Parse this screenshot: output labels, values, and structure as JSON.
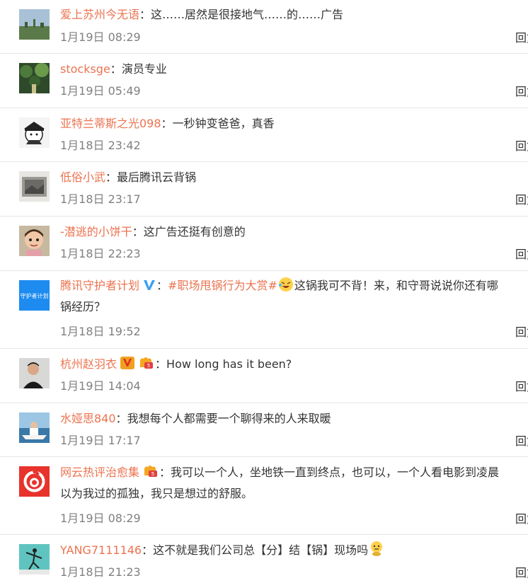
{
  "colors": {
    "username": "#eb7350",
    "time": "#808080",
    "text": "#333333",
    "divider": "#e6e6e6"
  },
  "comments": [
    {
      "user": "爱上苏州今无语",
      "colon": "：",
      "text": "这……居然是很接地气……的……广告",
      "time": "1月19日 08:29",
      "avatar_icon": "landscape-avatar-icon"
    },
    {
      "user": "stocksge",
      "colon": "：",
      "text": "演员专业",
      "time": "1月19日 05:49",
      "avatar_icon": "forest-avatar-icon"
    },
    {
      "user": "亚特兰蒂斯之光098",
      "colon": "：",
      "text": "一秒钟变爸爸，真香",
      "time": "1月18日 23:42",
      "avatar_icon": "cartoon-pilot-avatar-icon"
    },
    {
      "user": "低俗小武",
      "colon": "：",
      "text": "最后腾讯云背锅",
      "time": "1月18日 23:17",
      "avatar_icon": "sketch-avatar-icon"
    },
    {
      "user": "-潜逃的小饼干",
      "colon": "：",
      "text": "这广告还挺有创意的",
      "time": "1月18日 22:23",
      "avatar_icon": "child-avatar-icon"
    },
    {
      "user": "腾讯守护者计划",
      "colon": "：",
      "topic": "#职场甩锅行为大赏#",
      "text": "这锅我可不背！来，和守哥说说你还有哪",
      "text2": "锅经历？",
      "time": "1月18日 19:52",
      "avatar_icon": "shield-logo-avatar-icon",
      "avatar_text": "守护者计划",
      "verified_icon": "blue-v-verified-icon",
      "emoji_icon": "laughing-emoji-icon"
    },
    {
      "user": "杭州赵羽衣",
      "colon": "：",
      "text": "How long has it been?",
      "time": "1月19日 14:04",
      "avatar_icon": "portrait-avatar-icon",
      "verified_icon": "orange-v-verified-icon",
      "level_icon": "fan-badge-icon"
    },
    {
      "user": "水娅思840",
      "colon": "：",
      "text": "我想每个人都需要一个聊得来的人来取暖",
      "time": "1月19日 17:17",
      "avatar_icon": "boat-avatar-icon"
    },
    {
      "user": "网云热评治愈集",
      "colon": "：",
      "text": "我可以一个人，坐地铁一直到终点，也可以，一个人看电影到凌晨",
      "text2": "以为我过的孤独，我只是想过的舒服。",
      "time": "1月19日 08:29",
      "avatar_icon": "netease-music-avatar-icon",
      "level_icon": "fan-badge-icon"
    },
    {
      "user": "YANG7111146",
      "colon": "：",
      "text": "这不就是我们公司总【分】结【锅】现场吗",
      "time": "1月18日 21:23",
      "avatar_icon": "dancer-avatar-icon",
      "emoji_icon": "thinking-emoji-icon"
    }
  ],
  "reply_label": "回复"
}
